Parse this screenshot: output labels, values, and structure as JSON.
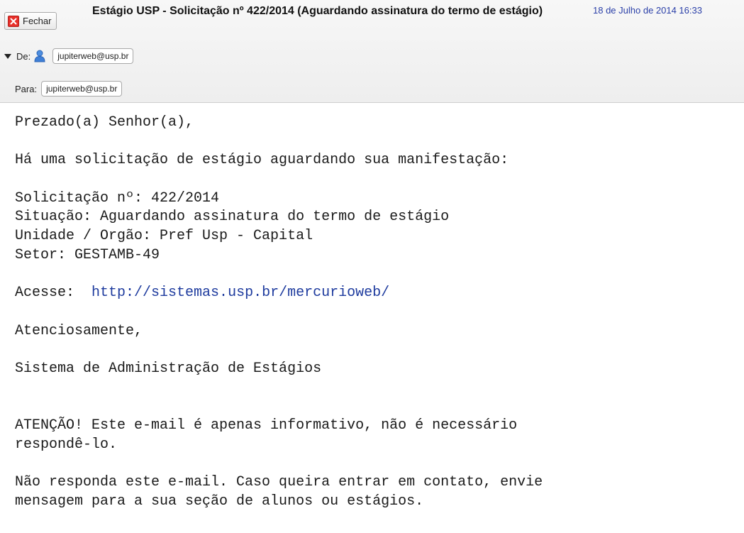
{
  "header": {
    "close_label": "Fechar",
    "subject": "Estágio USP - Solicitação nº 422/2014 (Aguardando assinatura do termo de estágio)",
    "date": "18 de Julho de 2014 16:33",
    "from_label": "De:",
    "from_address": "jupiterweb@usp.br",
    "to_label": "Para:",
    "to_address": "jupiterweb@usp.br"
  },
  "message": {
    "greeting": "Prezado(a) Senhor(a),",
    "intro": "Há uma solicitação de estágio aguardando sua manifestação:",
    "request_line": "Solicitação nº: 422/2014",
    "status_line": "Situação: Aguardando assinatura do termo de estágio",
    "unit_line": "Unidade / Orgão: Pref Usp - Capital",
    "sector_line": "Setor: GESTAMB-49",
    "access_label": "Acesse:",
    "access_link": "http://sistemas.usp.br/mercurioweb/",
    "closing": "Atenciosamente,",
    "signature": "Sistema de Administração de Estágios",
    "notice_line1": "ATENÇÃO! Este e-mail é apenas informativo, não é necessário",
    "notice_line2": "respondê-lo.",
    "reply_line1": "Não responda este e-mail. Caso queira entrar em contato, envie",
    "reply_line2": "mensagem para a sua seção de alunos ou estágios."
  },
  "colors": {
    "link": "#1e3b9e",
    "date": "#2a3fa8",
    "close_icon": "#e8302a"
  },
  "icons": {
    "close": "close-x-icon",
    "expand": "triangle-down-icon",
    "sender": "person-icon"
  }
}
